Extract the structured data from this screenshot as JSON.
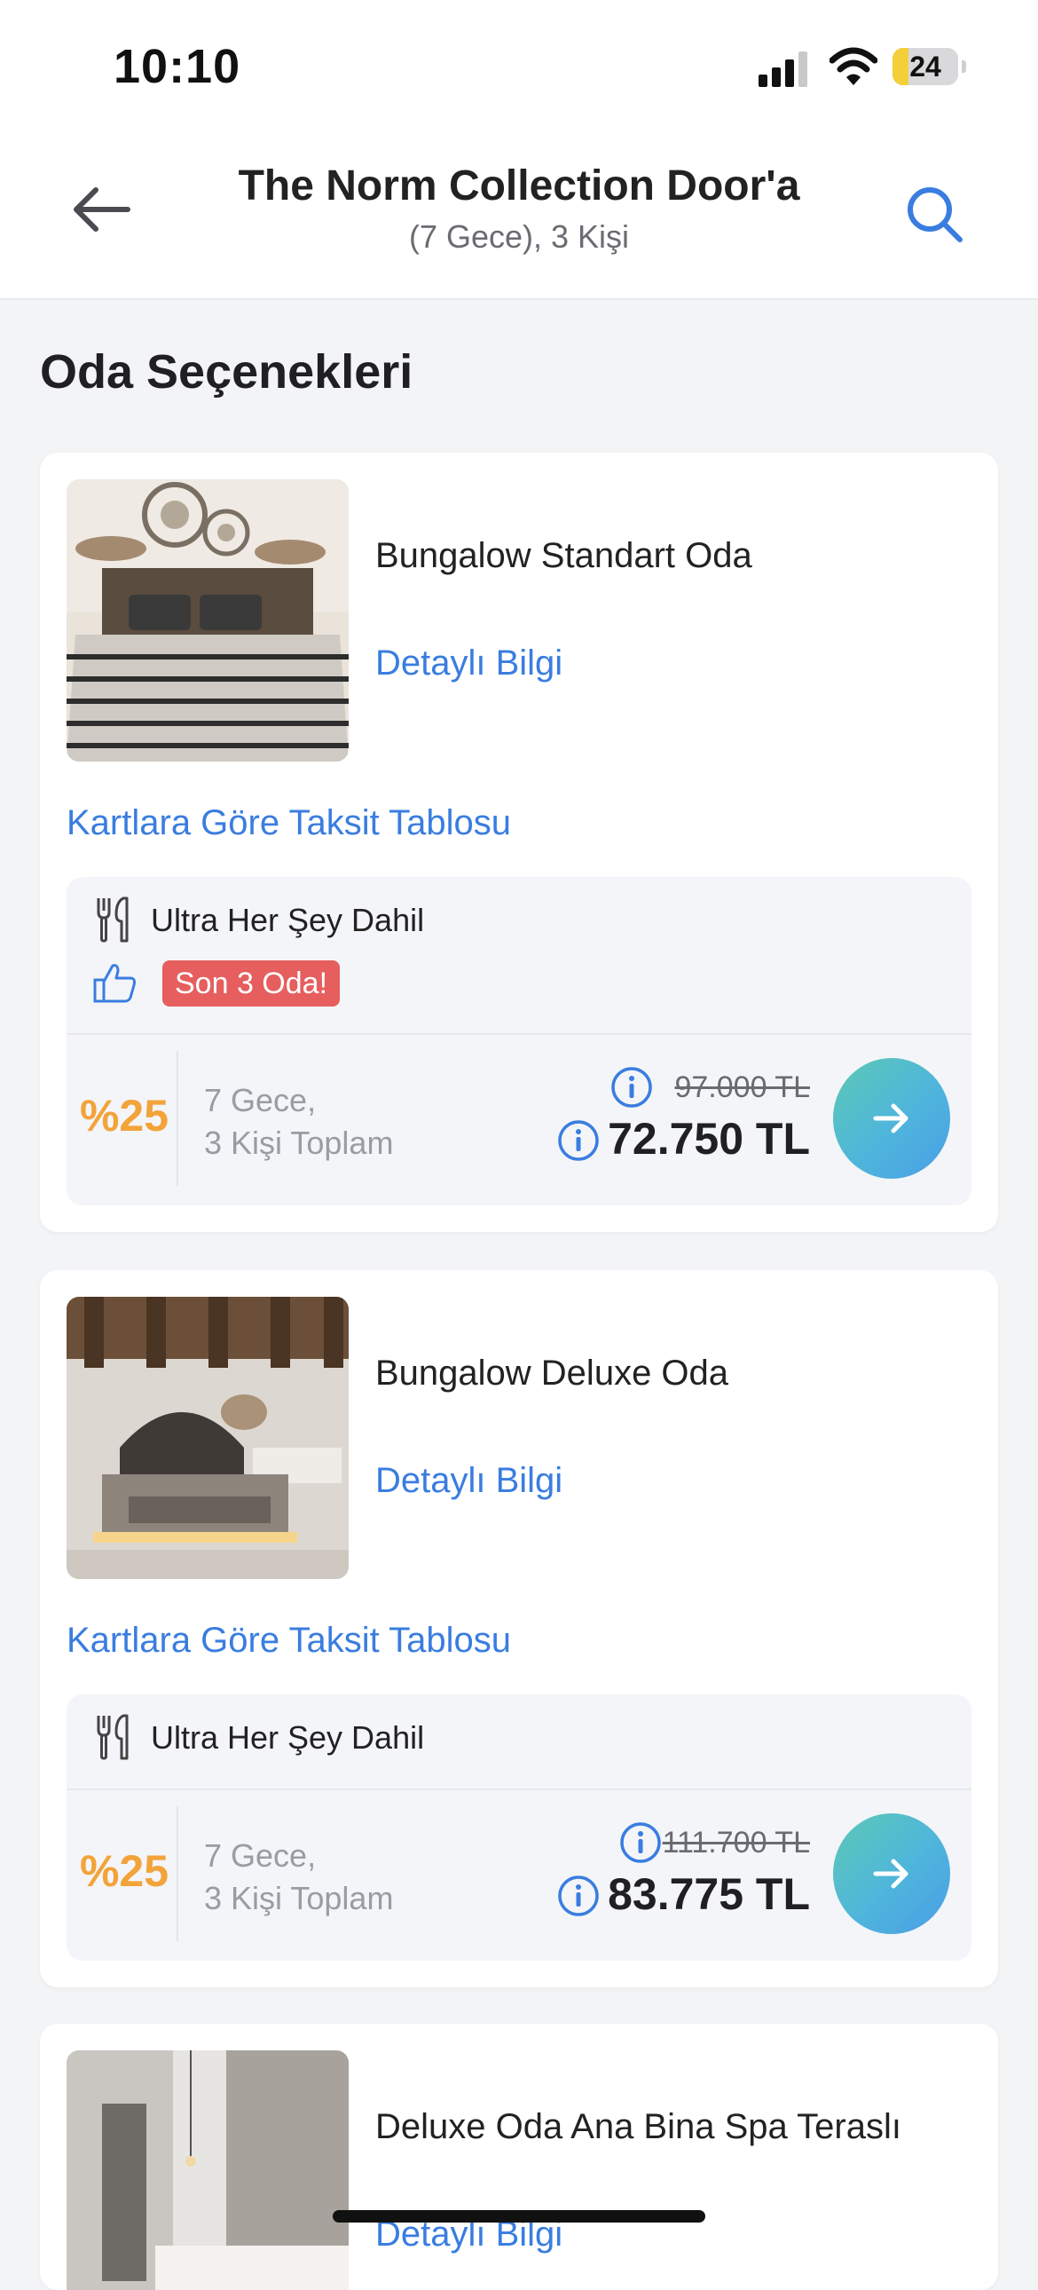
{
  "status_bar": {
    "time": "10:10",
    "battery": "24",
    "battery_level": 0.24
  },
  "header": {
    "title": "The Norm Collection Door'a",
    "subtitle": "(7 Gece), 3 Kişi"
  },
  "section_title": "Oda Seçenekleri",
  "rooms": [
    {
      "name": "Bungalow Standart Oda",
      "detail_link": "Detaylı Bilgi",
      "installment_link": "Kartlara Göre Taksit Tablosu",
      "board": "Ultra Her Şey Dahil",
      "badge": "Son 3 Oda!",
      "discount": "%25",
      "nights_line1": "7 Gece,",
      "nights_line2": "3 Kişi Toplam",
      "old_price": "97.000 TL",
      "new_price": "72.750 TL"
    },
    {
      "name": "Bungalow Deluxe Oda",
      "detail_link": "Detaylı Bilgi",
      "installment_link": "Kartlara Göre Taksit Tablosu",
      "board": "Ultra Her Şey Dahil",
      "discount": "%25",
      "nights_line1": "7 Gece,",
      "nights_line2": "3 Kişi Toplam",
      "old_price": "111.700 TL",
      "new_price": "83.775 TL"
    },
    {
      "name": "Deluxe Oda Ana Bina Spa Teraslı",
      "detail_link": "Detaylı Bilgi"
    }
  ],
  "colors": {
    "accent_blue": "#3a7de0",
    "discount_orange": "#f2a33a",
    "badge_red": "#e65e5e",
    "button_gradient": [
      "#5cc9b5",
      "#4a9ee6"
    ]
  },
  "icons": {
    "back": "arrow-left-icon",
    "search": "search-icon",
    "board": "fork-knife-icon",
    "thumb": "thumbs-up-icon",
    "info": "info-icon",
    "go": "arrow-right-icon"
  }
}
